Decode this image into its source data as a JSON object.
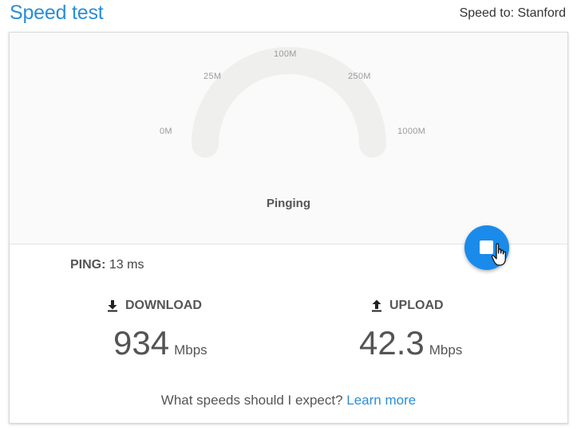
{
  "header": {
    "title": "Speed test",
    "speed_to": "Speed to: Stanford"
  },
  "gauge": {
    "ticks": [
      "0M",
      "25M",
      "100M",
      "250M",
      "1000M"
    ],
    "status": "Pinging",
    "fill_fraction": 0
  },
  "results": {
    "ping_label": "PING:",
    "ping_value": "13 ms",
    "download": {
      "label": "DOWNLOAD",
      "value": "934",
      "unit": "Mbps",
      "icon": "download-arrow-icon"
    },
    "upload": {
      "label": "UPLOAD",
      "value": "42.3",
      "unit": "Mbps",
      "icon": "upload-arrow-icon"
    }
  },
  "footer": {
    "question": "What speeds should I expect?",
    "link": "Learn more"
  },
  "colors": {
    "accent": "#2a8ed8",
    "button": "#1a8bea",
    "gauge_track": "#efefed"
  },
  "icons": {
    "stop": "stop-square-icon",
    "cursor": "hand-pointer-icon"
  }
}
